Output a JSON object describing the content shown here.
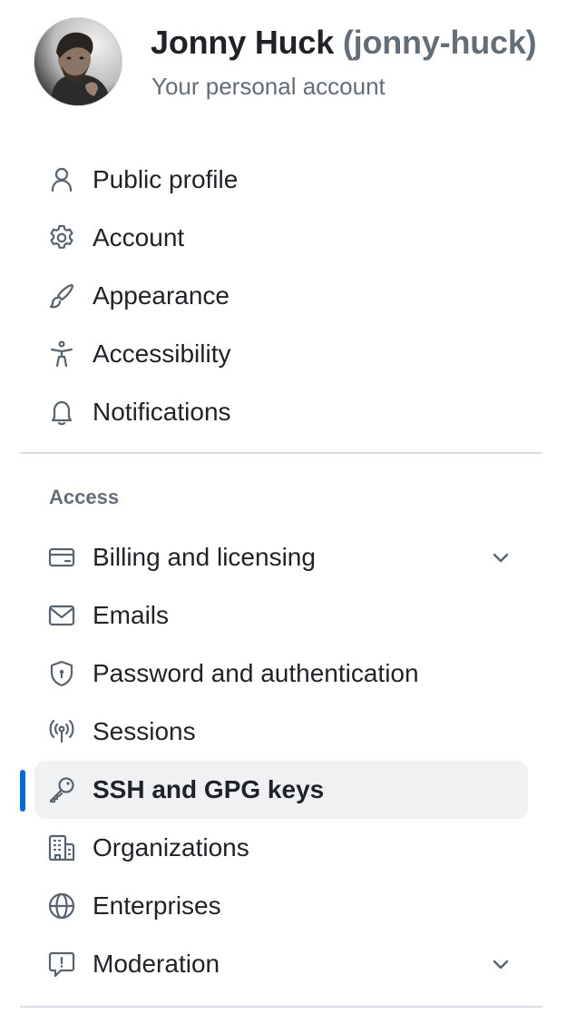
{
  "profile": {
    "display_name": "Jonny Huck",
    "username": "(jonny-huck)",
    "subtitle": "Your personal account"
  },
  "nav_group_1": [
    {
      "label": "Public profile",
      "icon": "person-icon"
    },
    {
      "label": "Account",
      "icon": "gear-icon"
    },
    {
      "label": "Appearance",
      "icon": "paintbrush-icon"
    },
    {
      "label": "Accessibility",
      "icon": "accessibility-icon"
    },
    {
      "label": "Notifications",
      "icon": "bell-icon"
    }
  ],
  "access": {
    "title": "Access",
    "items": [
      {
        "label": "Billing and licensing",
        "icon": "credit-card-icon",
        "expandable": true
      },
      {
        "label": "Emails",
        "icon": "mail-icon"
      },
      {
        "label": "Password and authentication",
        "icon": "shield-lock-icon"
      },
      {
        "label": "Sessions",
        "icon": "broadcast-icon"
      },
      {
        "label": "SSH and GPG keys",
        "icon": "key-icon",
        "active": true
      },
      {
        "label": "Organizations",
        "icon": "organization-icon"
      },
      {
        "label": "Enterprises",
        "icon": "globe-icon"
      },
      {
        "label": "Moderation",
        "icon": "report-icon",
        "expandable": true
      }
    ]
  },
  "colors": {
    "active_indicator": "#0969da",
    "active_background": "#eff1f3",
    "muted_text": "#656d76",
    "divider": "#d8dee4"
  }
}
